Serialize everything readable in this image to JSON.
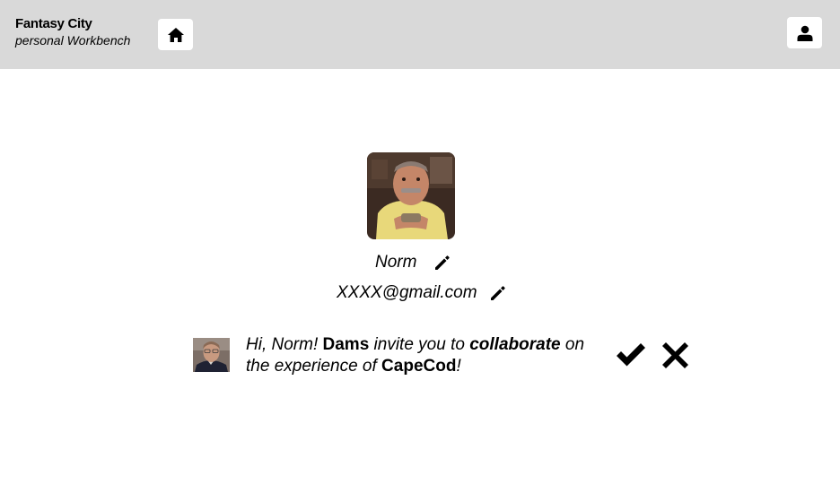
{
  "header": {
    "brand_title": "Fantasy City",
    "brand_subtitle": "personal Workbench",
    "home_icon": "home-icon",
    "profile_icon": "user-icon",
    "background": "#d9d9d9"
  },
  "profile": {
    "name": "Norm",
    "email": "XXXX@gmail.com",
    "edit_icon": "pencil-icon",
    "avatar": "profile-photo"
  },
  "invitation": {
    "greeting": "Hi, Norm!",
    "inviter": "Dams",
    "text_invite": "invite you to",
    "role": "collaborate",
    "text_on": "on",
    "text_experience": "the experience of",
    "experience": "CapeCod",
    "end_punct": "!",
    "accept_icon": "checkmark-icon",
    "decline_icon": "x-icon"
  }
}
